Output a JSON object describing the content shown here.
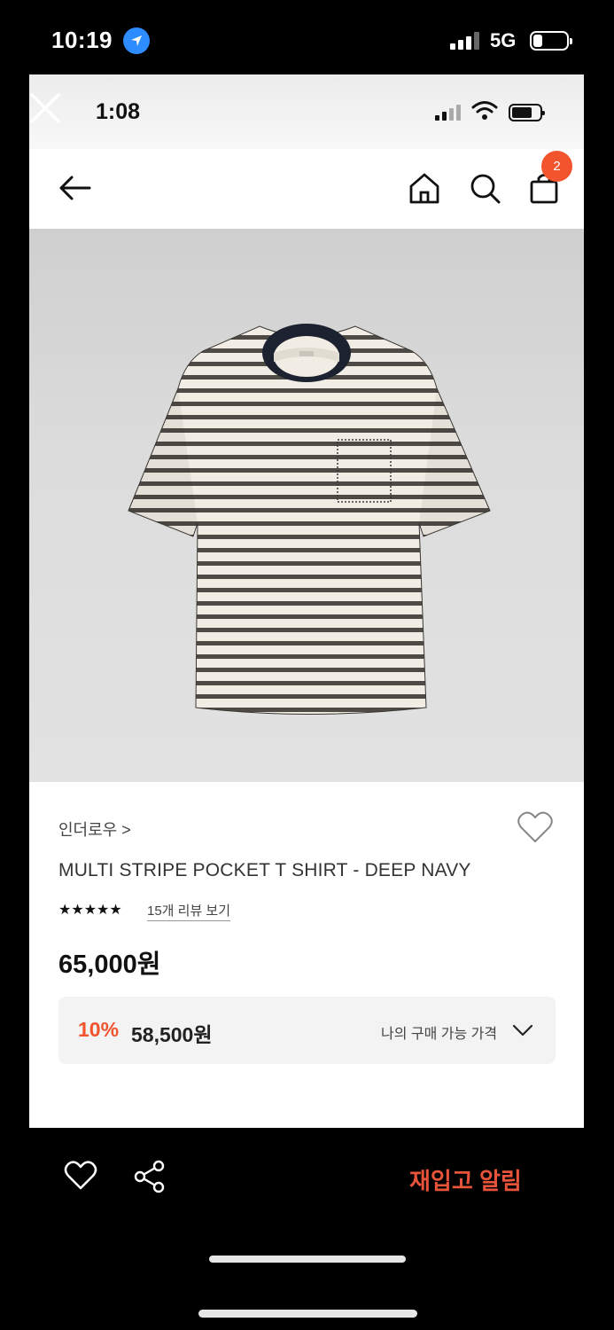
{
  "outer_status": {
    "time": "10:19",
    "network": "5G"
  },
  "inner_status": {
    "time": "1:08"
  },
  "header": {
    "cart_count": "2"
  },
  "product": {
    "brand": "인더로우",
    "brand_arrow": ">",
    "name": "MULTI STRIPE POCKET T SHIRT - DEEP NAVY",
    "stars": "★★★★★",
    "rating": 5,
    "review_link": "15개 리뷰 보기",
    "price": "65,000원"
  },
  "price_box": {
    "discount": "10%",
    "sale_price": "58,500원",
    "my_price_label": "나의 구매 가능 가격"
  },
  "bottom": {
    "restock_label": "재입고 알림"
  },
  "colors": {
    "accent": "#f2542d",
    "restock": "#e8543a",
    "stripe": "#4e4a45",
    "collar": "#1d2230"
  }
}
